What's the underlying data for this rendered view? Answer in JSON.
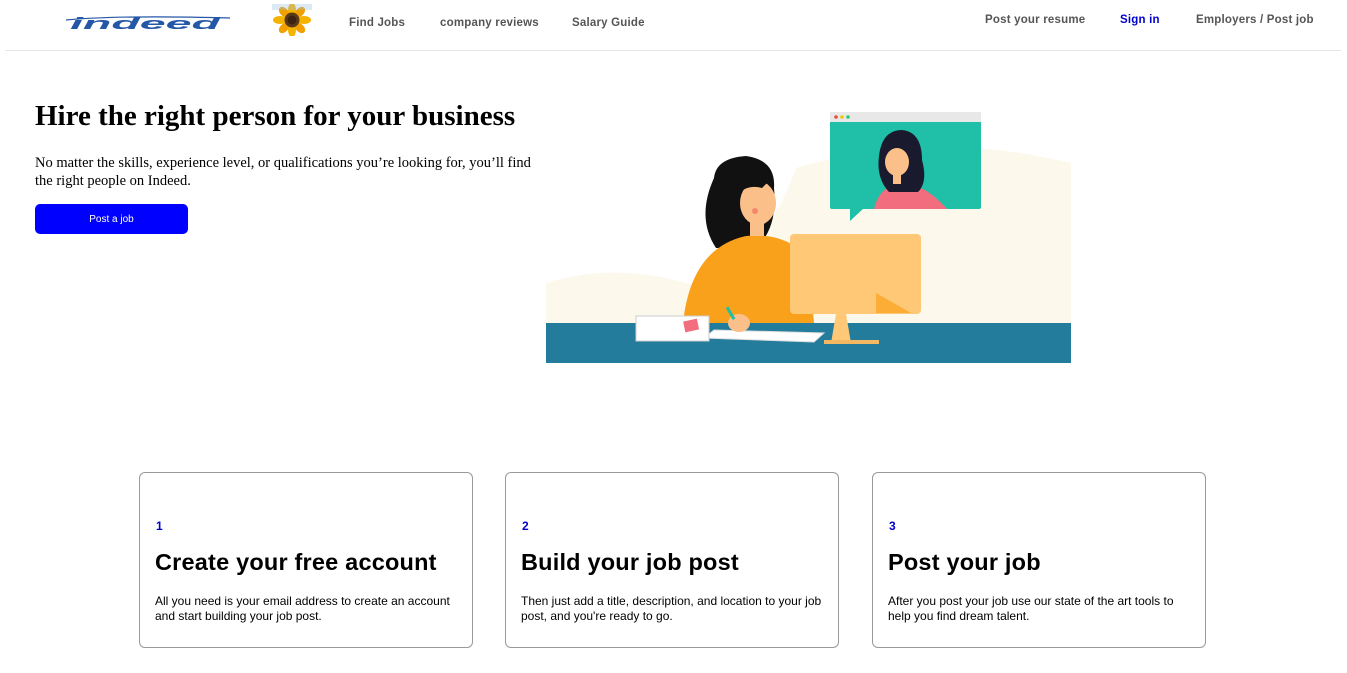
{
  "header": {
    "logo_text": "indeed",
    "nav": {
      "find_jobs": "Find Jobs",
      "company_reviews": "company reviews",
      "salary_guide": "Salary Guide",
      "post_resume": "Post your resume",
      "sign_in": "Sign in",
      "employers": "Employers / Post job"
    }
  },
  "hero": {
    "title": "Hire the right person for your business",
    "text": "No matter the skills, experience level, or qualifications you’re looking for, you’ll find the right people on Indeed.",
    "button_label": "Post a job"
  },
  "steps": [
    {
      "number": "1",
      "title": "Create your free account",
      "description": "All you need is your email address to create an account and start building your job post."
    },
    {
      "number": "2",
      "title": "Build your job post",
      "description": "Then just add a title, description, and location to your job post, and you're ready to go."
    },
    {
      "number": "3",
      "title": "Post your job",
      "description": "After you post your job use our state of the art tools to help you find dream talent."
    }
  ],
  "colors": {
    "accent_blue": "#0000ff",
    "link_blue": "#0000cc",
    "logo_blue": "#2557a7",
    "desk": "#237c9c",
    "sweater": "#f9a11b",
    "video_bg": "#1fbfa8"
  }
}
